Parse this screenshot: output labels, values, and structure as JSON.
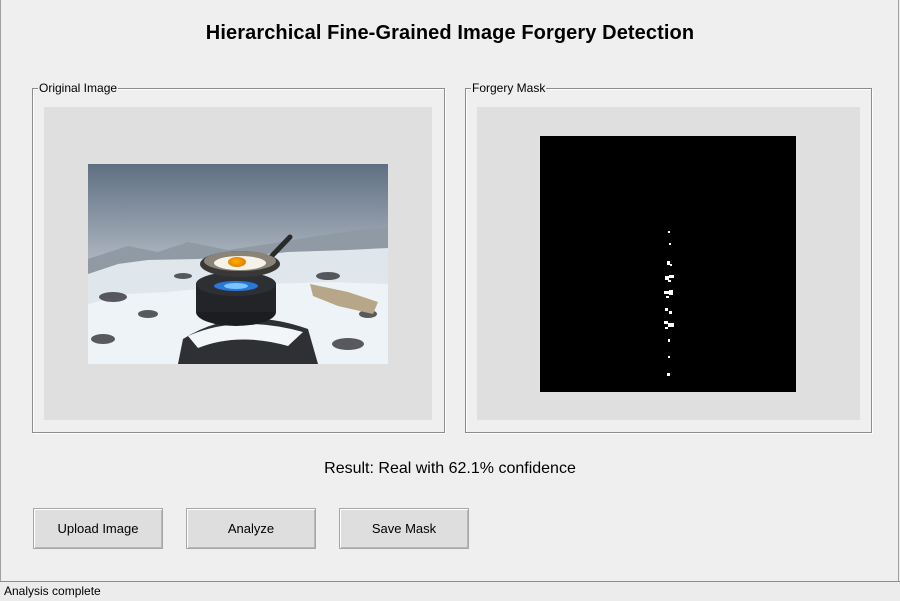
{
  "app": {
    "title": "Hierarchical Fine-Grained Image Forgery Detection"
  },
  "panels": {
    "original": {
      "label": "Original Image"
    },
    "mask": {
      "label": "Forgery Mask"
    }
  },
  "result": {
    "text": "Result: Real with 62.1% confidence"
  },
  "buttons": {
    "upload_label": "Upload Image",
    "analyze_label": "Analyze",
    "save_label": "Save Mask"
  },
  "status": {
    "text": "Analysis complete"
  },
  "colors": {
    "window_bg": "#efefef",
    "canvas_bg": "#dfdfdf",
    "button_bg": "#dedede",
    "mask_bg": "#000000",
    "mask_fg": "#ffffff"
  }
}
